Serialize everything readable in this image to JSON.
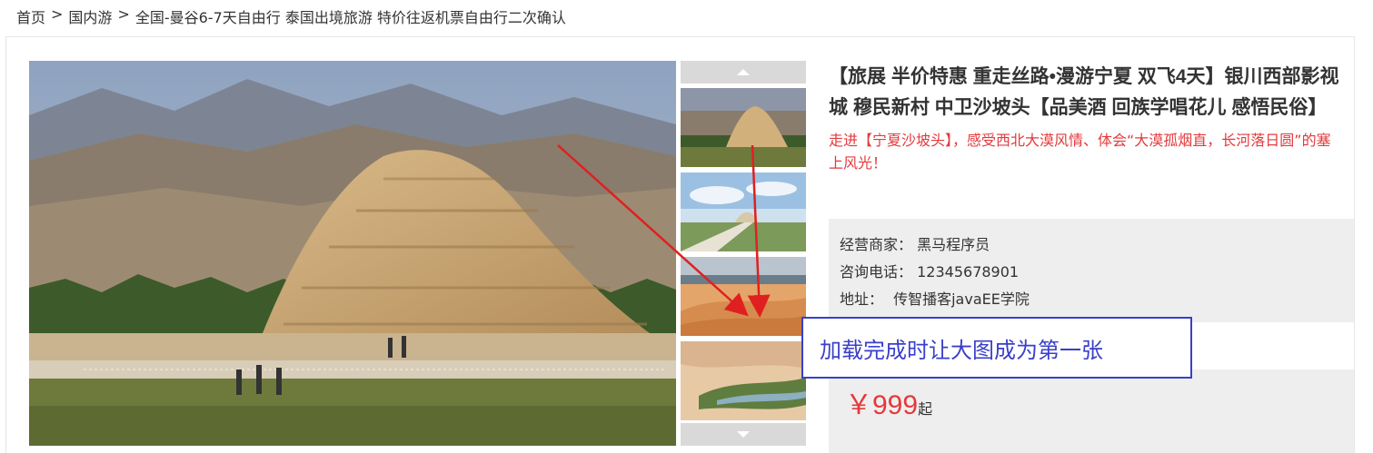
{
  "breadcrumb": {
    "items": [
      "首页",
      "国内游",
      "全国-曼谷6-7天自由行 泰国出境旅游 特价往返机票自由行二次确认"
    ],
    "separator": ">"
  },
  "product": {
    "title": "【旅展 半价特惠 重走丝路•漫游宁夏 双飞4天】银川西部影视城 穆民新村 中卫沙坡头【品美酒 回族学唱花儿 感悟民俗】",
    "subtitle": "走进【宁夏沙坡头】，感受西北大漠风情、体会“大漠孤烟直，长河落日圆”的塞上风光！"
  },
  "merchant": {
    "name_label": "经营商家：",
    "name_value": "黑马程序员",
    "phone_label": "咨询电话：",
    "phone_value": "12345678901",
    "address_label": "地址：",
    "address_value": "传智播客javaEE学院"
  },
  "price": {
    "symbol": "￥",
    "value": "999",
    "unit": "起"
  },
  "annotation": {
    "text": "加载完成时让大图成为第一张"
  },
  "icons": {
    "up": "chevron-up-icon",
    "down": "chevron-down-icon"
  },
  "colors": {
    "accent_red": "#e4393c",
    "annotation_blue": "#3a3fc9",
    "gray_box": "#eeeeee"
  }
}
